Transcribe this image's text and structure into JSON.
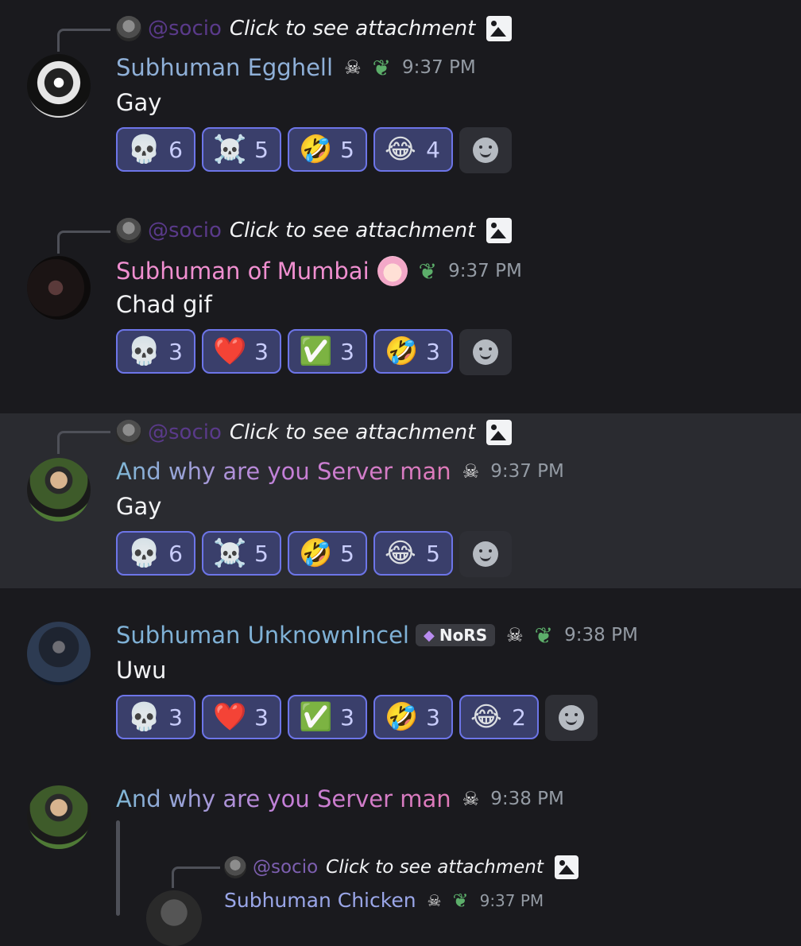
{
  "messages": [
    {
      "reply": {
        "mention": "@socio",
        "attachment_text": "Click to see attachment"
      },
      "author": "Subhuman Egghell",
      "badges": [
        "skull",
        "heart"
      ],
      "time": "9:37 PM",
      "text": "Gay",
      "reactions": [
        {
          "emoji": "💀",
          "count": "6"
        },
        {
          "emoji": "☠️",
          "count": "5"
        },
        {
          "emoji": "🤣",
          "count": "5"
        },
        {
          "emoji": "😂",
          "count": "4"
        }
      ]
    },
    {
      "reply": {
        "mention": "@socio",
        "attachment_text": "Click to see attachment"
      },
      "author": "Subhuman of Mumbai",
      "badges": [
        "anime-avatar",
        "heart"
      ],
      "time": "9:37 PM",
      "text": "Chad gif",
      "reactions": [
        {
          "emoji": "💀",
          "count": "3"
        },
        {
          "emoji": "❤️",
          "count": "3"
        },
        {
          "emoji": "✅",
          "count": "3"
        },
        {
          "emoji": "🤣",
          "count": "3"
        }
      ]
    },
    {
      "reply": {
        "mention": "@socio",
        "attachment_text": "Click to see attachment"
      },
      "author": "And why are you Server man",
      "badges": [
        "skull"
      ],
      "time": "9:37 PM",
      "text": "Gay",
      "reactions": [
        {
          "emoji": "💀",
          "count": "6"
        },
        {
          "emoji": "☠️",
          "count": "5"
        },
        {
          "emoji": "🤣",
          "count": "5"
        },
        {
          "emoji": "😂",
          "count": "5"
        }
      ]
    },
    {
      "author": "Subhuman UnknownIncel",
      "tag": "NoRS",
      "badges": [
        "skull",
        "heart"
      ],
      "time": "9:38 PM",
      "text": "Uwu",
      "reactions": [
        {
          "emoji": "💀",
          "count": "3"
        },
        {
          "emoji": "❤️",
          "count": "3"
        },
        {
          "emoji": "✅",
          "count": "3"
        },
        {
          "emoji": "🤣",
          "count": "3"
        },
        {
          "emoji": "😂",
          "count": "2"
        }
      ]
    },
    {
      "author": "And why are you Server man",
      "badges": [
        "skull"
      ],
      "time": "9:38 PM",
      "nested": {
        "reply": {
          "mention": "@socio",
          "attachment_text": "Click to see attachment"
        },
        "author": "Subhuman Chicken",
        "time": "9:37 PM"
      }
    }
  ],
  "icons": {
    "skull_badge": "☠",
    "heart_badge": "❦",
    "gem": "◆"
  }
}
